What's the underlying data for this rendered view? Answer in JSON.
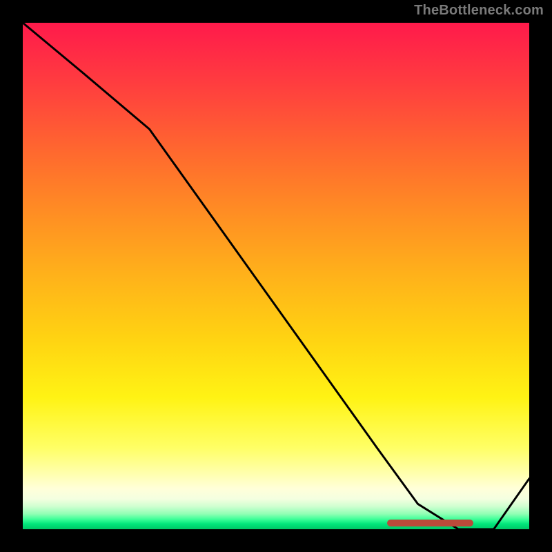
{
  "watermark": "TheBottleneck.com",
  "colors": {
    "line": "#000000",
    "marker": "#bb4a3a"
  },
  "chart_data": {
    "type": "line",
    "title": "",
    "xlabel": "",
    "ylabel": "",
    "xlim": [
      0,
      100
    ],
    "ylim": [
      0,
      100
    ],
    "grid": false,
    "series": [
      {
        "name": "curve",
        "x": [
          0,
          12,
          25,
          40,
          55,
          70,
          78,
          86,
          93,
          100
        ],
        "y": [
          100,
          90,
          79,
          58,
          37,
          16,
          5,
          0,
          0,
          10
        ]
      }
    ],
    "marker": {
      "x_start": 72,
      "x_end": 89,
      "y": 0
    }
  }
}
